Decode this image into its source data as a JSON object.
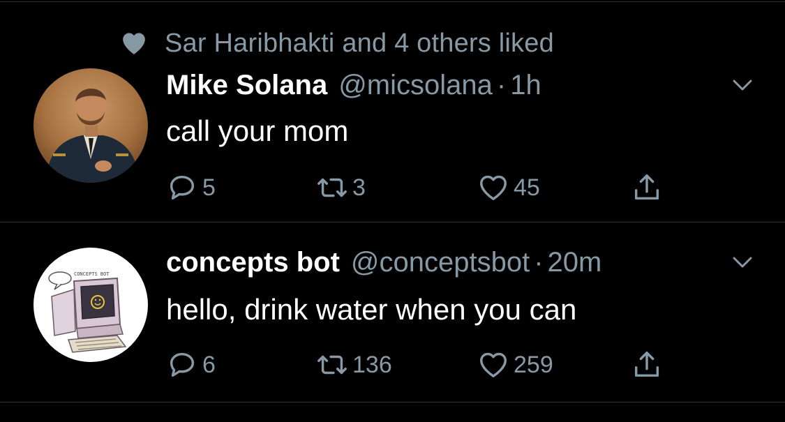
{
  "social_context": {
    "text": "Sar Haribhakti and 4 others liked",
    "icon": "heart-icon"
  },
  "colors": {
    "background": "#000000",
    "primary_text": "#ffffff",
    "secondary_text": "#8899a6",
    "divider": "#2f3336"
  },
  "tweets": [
    {
      "name": "Mike Solana",
      "handle": "@micsolana",
      "separator": "·",
      "time": "1h",
      "text": "call your mom",
      "replies": "5",
      "retweets": "3",
      "likes": "45",
      "avatar": "portrait-avatar"
    },
    {
      "name": "concepts bot",
      "handle": "@conceptsbot",
      "separator": "·",
      "time": "20m",
      "text": "hello, drink water when you can",
      "replies": "6",
      "retweets": "136",
      "likes": "259",
      "avatar": "retro-computer-avatar"
    }
  ]
}
